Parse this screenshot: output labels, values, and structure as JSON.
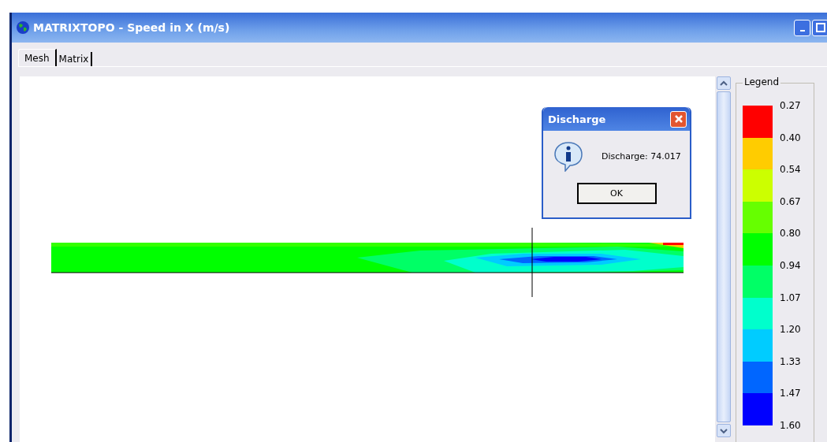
{
  "window": {
    "title": "MATRIXTOPO - Speed in X (m/s)"
  },
  "tabs": [
    {
      "label": "Mesh",
      "selected": true
    },
    {
      "label": "Matrix",
      "selected": false
    }
  ],
  "legend": {
    "title": "Legend",
    "bands": [
      {
        "color": "#ff0000"
      },
      {
        "color": "#ffcc00"
      },
      {
        "color": "#ccff00"
      },
      {
        "color": "#66ff00"
      },
      {
        "color": "#00ff00"
      },
      {
        "color": "#00ff66"
      },
      {
        "color": "#00ffcc"
      },
      {
        "color": "#00ccff"
      },
      {
        "color": "#0066ff"
      },
      {
        "color": "#0000ff"
      }
    ],
    "labels": [
      "0.27",
      "0.40",
      "0.54",
      "0.67",
      "0.80",
      "0.94",
      "1.07",
      "1.20",
      "1.33",
      "1.47",
      "1.60"
    ]
  },
  "dialog": {
    "title": "Discharge",
    "message": "Discharge: 74.017",
    "button": "OK"
  }
}
